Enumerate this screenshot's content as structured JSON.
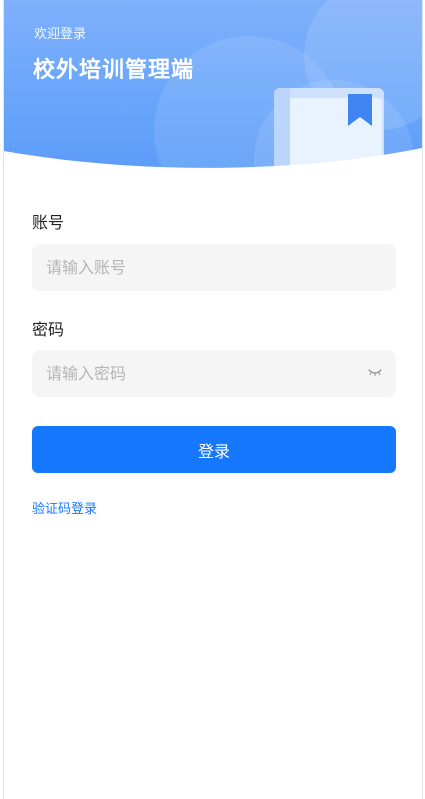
{
  "header": {
    "welcome": "欢迎登录",
    "title": "校外培训管理端"
  },
  "form": {
    "account_label": "账号",
    "account_placeholder": "请输入账号",
    "account_value": "",
    "password_label": "密码",
    "password_placeholder": "请输入密码",
    "password_value": "",
    "password_toggle_icon": "eye-closed-icon"
  },
  "actions": {
    "login_label": "登录",
    "code_login_label": "验证码登录"
  },
  "colors": {
    "primary": "#1677ff",
    "header_gradient_top": "#7fb0fb",
    "input_bg": "#f5f5f5"
  }
}
